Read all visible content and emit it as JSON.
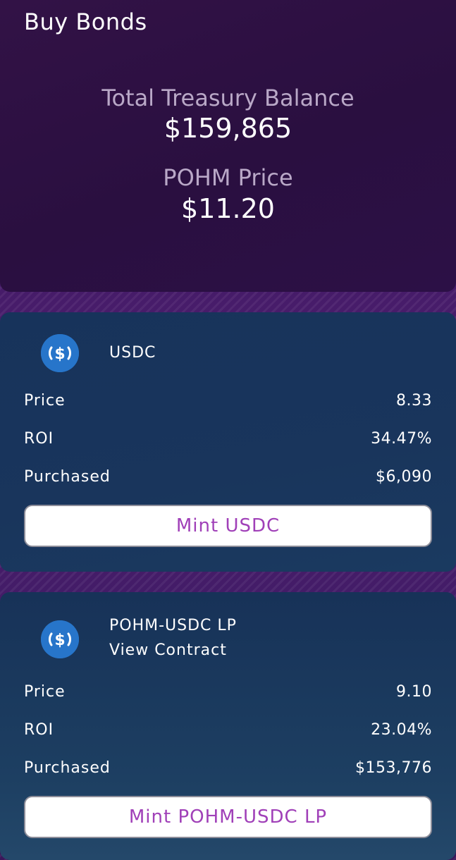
{
  "header": {
    "title": "Buy Bonds",
    "treasury_label": "Total Treasury Balance",
    "treasury_value": "$159,865",
    "price_label": "POHM Price",
    "price_value": "$11.20"
  },
  "bonds": [
    {
      "name": "USDC",
      "icon": "usdc-dollar-icon",
      "price_label": "Price",
      "price": "8.33",
      "roi_label": "ROI",
      "roi": "34.47%",
      "purchased_label": "Purchased",
      "purchased": "$6,090",
      "mint_label": "Mint USDC"
    },
    {
      "name": "POHM-USDC LP",
      "view_contract": "View Contract",
      "icon": "usdc-dollar-icon",
      "price_label": "Price",
      "price": "9.10",
      "roi_label": "ROI",
      "roi": "23.04%",
      "purchased_label": "Purchased",
      "purchased": "$153,776",
      "mint_label": "Mint POHM-USDC LP"
    }
  ],
  "colors": {
    "header_bg": "#2a0f40",
    "card_bg": "#17335b",
    "mint_text": "#a040b8",
    "usdc_blue": "#2775ca"
  }
}
